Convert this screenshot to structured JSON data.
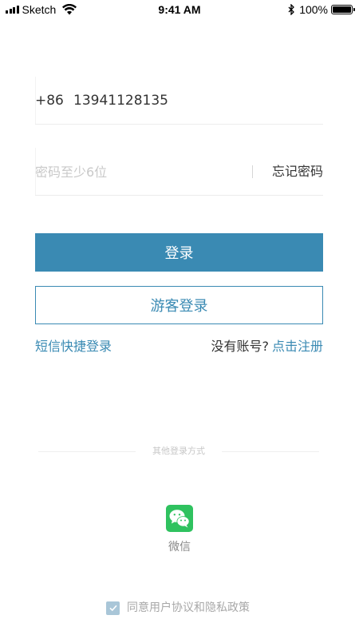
{
  "status_bar": {
    "carrier": "Sketch",
    "time": "9:41 AM",
    "battery": "100%",
    "battery_level": 1.0
  },
  "login_form": {
    "country_code": "+86",
    "phone_value": "13941128135",
    "password_placeholder": "密码至少6位",
    "forgot_password": "忘记密码",
    "login_button": "登录",
    "guest_button": "游客登录",
    "sms_login": "短信快捷登录",
    "no_account": "没有账号?",
    "register": "点击注册"
  },
  "other_login": {
    "title": "其他登录方式",
    "wechat_label": "微信",
    "wechat_icon": "wechat-icon"
  },
  "agreement": {
    "checked": true,
    "text": "同意用户协议和隐私政策"
  },
  "colors": {
    "accent": "#3a8ab3",
    "wechat": "#2fc25f",
    "checkbox": "#a9c6d8"
  }
}
